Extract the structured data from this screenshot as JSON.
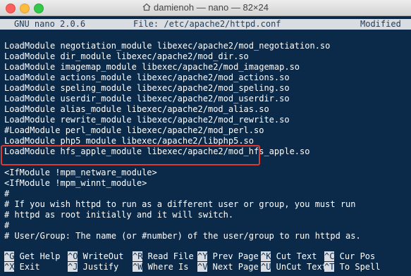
{
  "window": {
    "title": "damienoh — nano — 82×24",
    "icon": "home-icon"
  },
  "status": {
    "version": "GNU nano 2.0.6",
    "file": "File: /etc/apache2/httpd.conf",
    "state": "Modified"
  },
  "lines": [
    "LoadModule negotiation_module libexec/apache2/mod_negotiation.so",
    "LoadModule dir_module libexec/apache2/mod_dir.so",
    "LoadModule imagemap_module libexec/apache2/mod_imagemap.so",
    "LoadModule actions_module libexec/apache2/mod_actions.so",
    "LoadModule speling_module libexec/apache2/mod_speling.so",
    "LoadModule userdir_module libexec/apache2/mod_userdir.so",
    "LoadModule alias_module libexec/apache2/mod_alias.so",
    "LoadModule rewrite_module libexec/apache2/mod_rewrite.so",
    "#LoadModule perl_module libexec/apache2/mod_perl.so",
    "LoadModule php5_module libexec/apache2/libphp5.so",
    "LoadModule hfs_apple_module libexec/apache2/mod_hfs_apple.so",
    "",
    "<IfModule !mpm_netware_module>",
    "<IfModule !mpm_winnt_module>",
    "#",
    "# If you wish httpd to run as a different user or group, you must run",
    "# httpd as root initially and it will switch.",
    "#",
    "# User/Group: The name (or #number) of the user/group to run httpd as."
  ],
  "shortcuts": [
    {
      "key": "^G",
      "label": "Get Help"
    },
    {
      "key": "^O",
      "label": "WriteOut"
    },
    {
      "key": "^R",
      "label": "Read File"
    },
    {
      "key": "^Y",
      "label": "Prev Page"
    },
    {
      "key": "^K",
      "label": "Cut Text"
    },
    {
      "key": "^C",
      "label": "Cur Pos"
    },
    {
      "key": "^X",
      "label": "Exit"
    },
    {
      "key": "^J",
      "label": "Justify"
    },
    {
      "key": "^W",
      "label": "Where Is"
    },
    {
      "key": "^V",
      "label": "Next Page"
    },
    {
      "key": "^U",
      "label": "UnCut Text"
    },
    {
      "key": "^T",
      "label": "To Spell"
    }
  ],
  "colors": {
    "background": "#0b2a4a",
    "text": "#ffffff",
    "statusbar": "#d9dce0",
    "highlight_border": "#e03a2f"
  }
}
